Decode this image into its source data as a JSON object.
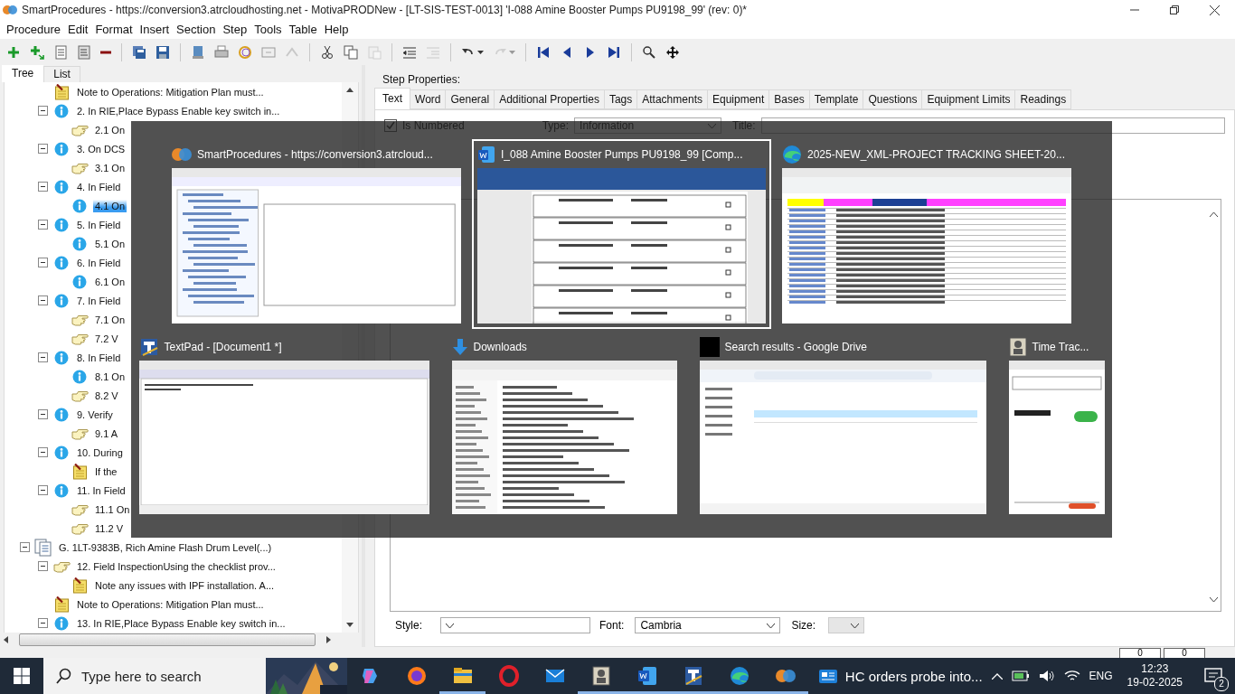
{
  "window": {
    "title": "SmartProcedures - https://conversion3.atrcloudhosting.net - MotivaPRODNew - [LT-SIS-TEST-0013] 'I-088 Amine Booster Pumps PU9198_99' (rev: 0)*"
  },
  "menu": [
    "Procedure",
    "Edit",
    "Format",
    "Insert",
    "Section",
    "Step",
    "Tools",
    "Table",
    "Help"
  ],
  "toolbar": [
    {
      "disabled": false
    },
    {
      "disabled": false
    },
    {
      "disabled": false
    },
    {
      "disabled": false
    },
    {
      "disabled": false
    },
    {
      "disabled": false
    },
    {
      "disabled": false
    },
    {
      "disabled": false
    },
    {
      "disabled": false
    },
    {
      "disabled": false
    },
    {
      "disabled": false
    },
    {
      "disabled": true
    },
    {
      "disabled": false
    },
    {
      "disabled": false
    },
    {
      "disabled": true
    },
    {
      "disabled": false
    },
    {
      "disabled": true
    },
    {
      "disabled": false
    },
    {
      "disabled": true
    },
    {
      "disabled": false
    },
    {
      "disabled": false
    },
    {
      "disabled": false
    },
    {
      "disabled": false
    },
    {
      "disabled": false
    },
    {
      "disabled": false
    }
  ],
  "left_panel": {
    "tabs": [
      {
        "label": "Tree",
        "selected": true
      },
      {
        "label": "List",
        "selected": false
      }
    ],
    "tree": [
      {
        "kind": "note",
        "text": "Note to Operations: Mitigation Plan must...",
        "selected": false
      },
      {
        "kind": "info",
        "text": "2. In RIE,Place Bypass Enable key switch in...",
        "selected": false,
        "expanded": true,
        "children": [
          {
            "kind": "hand",
            "text": "2.1 On",
            "selected": false
          }
        ]
      },
      {
        "kind": "info",
        "text": "3. On DCS",
        "selected": false,
        "expanded": true,
        "children": [
          {
            "kind": "hand",
            "text": "3.1 On",
            "selected": false
          }
        ]
      },
      {
        "kind": "info",
        "text": "4. In Field",
        "selected": false,
        "expanded": true,
        "children": [
          {
            "kind": "info",
            "text": "4.1 On",
            "selected": true
          }
        ]
      },
      {
        "kind": "info",
        "text": "5. In Field",
        "selected": false,
        "expanded": true,
        "children": [
          {
            "kind": "info",
            "text": "5.1 On",
            "selected": false
          }
        ]
      },
      {
        "kind": "info",
        "text": "6. In Field",
        "selected": false,
        "expanded": true,
        "children": [
          {
            "kind": "info",
            "text": "6.1 On",
            "selected": false
          }
        ]
      },
      {
        "kind": "info",
        "text": "7. In Field",
        "selected": false,
        "expanded": true,
        "children": [
          {
            "kind": "hand",
            "text": "7.1 On",
            "selected": false
          },
          {
            "kind": "hand",
            "text": "7.2 V",
            "selected": false
          }
        ]
      },
      {
        "kind": "info",
        "text": "8. In Field",
        "selected": false,
        "expanded": true,
        "children": [
          {
            "kind": "info",
            "text": "8.1 On",
            "selected": false
          },
          {
            "kind": "hand",
            "text": "8.2 V",
            "selected": false
          }
        ]
      },
      {
        "kind": "info",
        "text": "9. Verify",
        "selected": false,
        "expanded": true,
        "children": [
          {
            "kind": "hand",
            "text": "9.1 A",
            "selected": false
          }
        ]
      },
      {
        "kind": "info",
        "text": "10. During",
        "selected": false,
        "expanded": true,
        "children": [
          {
            "kind": "note",
            "text": "If the",
            "selected": false
          }
        ]
      },
      {
        "kind": "info",
        "text": "11. In Field",
        "selected": false,
        "expanded": true,
        "children": [
          {
            "kind": "hand",
            "text": "11.1 On",
            "selected": false
          },
          {
            "kind": "hand",
            "text": "11.2 V",
            "selected": false
          }
        ]
      },
      {
        "kind": "section",
        "text": "G. 1LT-9383B, Rich Amine Flash Drum Level(...)",
        "selected": false,
        "expanded": true,
        "children": [
          {
            "kind": "hand",
            "text": "12. Field InspectionUsing the checklist prov...",
            "selected": false,
            "expanded": true,
            "children": [
              {
                "kind": "note",
                "text": "Note any issues with IPF installation. A...",
                "selected": false
              }
            ]
          },
          {
            "kind": "note",
            "text": "Note to Operations: Mitigation Plan must...",
            "selected": false
          },
          {
            "kind": "info",
            "text": "13. In RIE,Place Bypass Enable key switch in...",
            "selected": false,
            "expanded": true
          }
        ]
      }
    ]
  },
  "step_properties": {
    "label": "Step Properties:",
    "tabs": [
      {
        "label": "Text",
        "selected": true
      },
      {
        "label": "Word",
        "selected": false
      },
      {
        "label": "General",
        "selected": false
      },
      {
        "label": "Additional Properties",
        "selected": false
      },
      {
        "label": "Tags",
        "selected": false
      },
      {
        "label": "Attachments",
        "selected": false
      },
      {
        "label": "Equipment",
        "selected": false
      },
      {
        "label": "Bases",
        "selected": false
      },
      {
        "label": "Template",
        "selected": false
      },
      {
        "label": "Questions",
        "selected": false
      },
      {
        "label": "Equipment Limits",
        "selected": false
      },
      {
        "label": "Readings",
        "selected": false
      }
    ],
    "is_numbered": {
      "label": "Is Numbered",
      "checked": true
    },
    "type": {
      "label": "Type:",
      "value": "Information"
    },
    "title": {
      "label": "Title:"
    },
    "style": {
      "label": "Style:"
    },
    "font": {
      "label": "Font:",
      "value": "Cambria"
    },
    "size": {
      "label": "Size:",
      "disabled": true
    }
  },
  "status_bar": {
    "fields": [
      "0",
      "0"
    ]
  },
  "task_switcher": {
    "windows": [
      {
        "kind": "procedures",
        "title": "SmartProcedures - https://conversion3.atrcloud...",
        "selected": false
      },
      {
        "kind": "document",
        "title": "I_088 Amine Booster Pumps PU9198_99 [Comp...",
        "selected": true
      },
      {
        "kind": "spreadsheet",
        "title": "2025-NEW_XML-PROJECT TRACKING SHEET-20...",
        "selected": false
      },
      {
        "kind": "editor",
        "title": "TextPad - [Document1 *]",
        "selected": false
      },
      {
        "kind": "explorer",
        "title": "Downloads",
        "selected": false
      },
      {
        "kind": "drive",
        "title": "Search results - Google Drive",
        "selected": false
      },
      {
        "kind": "tracker",
        "title": "Time Trac...",
        "selected": false
      }
    ]
  },
  "taskbar": {
    "search": {
      "placeholder": "Type here to search"
    },
    "apps": [
      {
        "kind": "copilot",
        "running": false
      },
      {
        "kind": "firefox",
        "running": false
      },
      {
        "kind": "files",
        "running": true
      },
      {
        "kind": "opera",
        "running": false
      },
      {
        "kind": "mail",
        "running": false
      },
      {
        "kind": "tracker",
        "running": true
      },
      {
        "kind": "word",
        "running": true
      },
      {
        "kind": "textpad",
        "running": true
      },
      {
        "kind": "edge",
        "running": true
      },
      {
        "kind": "procedures",
        "running": true
      }
    ],
    "news": "HC orders probe into...",
    "language": "ENG",
    "time": "12:23",
    "date": "19-02-2025",
    "notifications": "2"
  }
}
